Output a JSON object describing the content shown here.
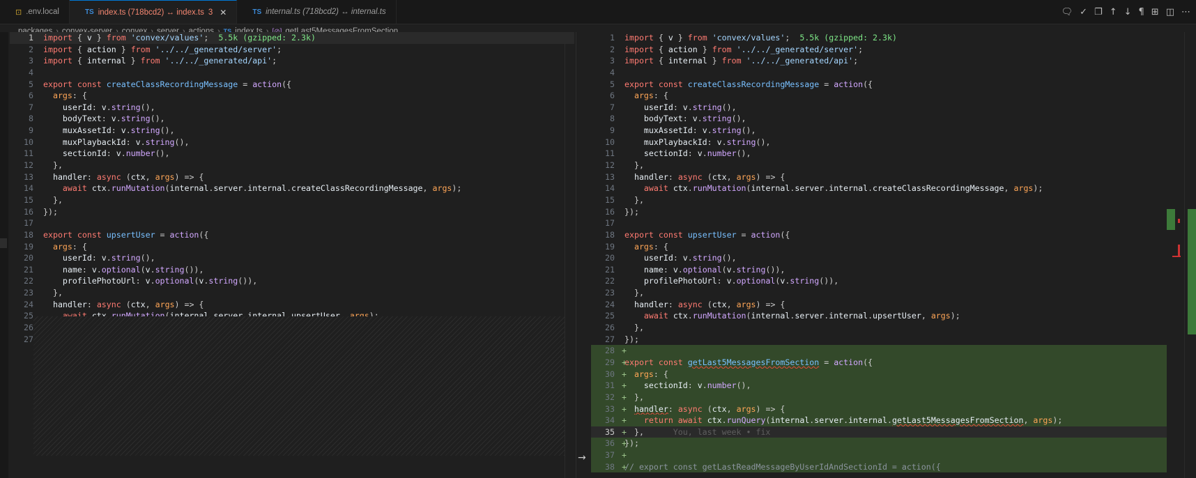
{
  "tabs": [
    {
      "icon": "env-icon",
      "label": ".env.local",
      "active": false
    },
    {
      "icon": "ts-icon",
      "label": "index.ts (718bcd2) ↔ index.ts",
      "badge": "3",
      "active": true
    },
    {
      "icon": "ts-icon",
      "label": "internal.ts (718bcd2) ↔ internal.ts",
      "active": false
    }
  ],
  "tab_icon_text": "TS",
  "tab_close": "✕",
  "toolbar": [
    "comment-icon",
    "check-icon",
    "copy-icon",
    "arrow-up-icon",
    "arrow-down-icon",
    "pilcrow-icon",
    "book-icon",
    "split-icon",
    "more-icon"
  ],
  "breadcrumbs": [
    "packages",
    "convex-server",
    "convex",
    "server",
    "actions",
    "index.ts",
    "getLast5MessagesFromSection"
  ],
  "left_lines": [
    "import { v } from 'convex/values';  5.5k (gzipped: 2.3k)",
    "import { action } from '../../_generated/server';",
    "import { internal } from '../../_generated/api';",
    "",
    "export const createClassRecordingMessage = action({",
    "  args: {",
    "    userId: v.string(),",
    "    bodyText: v.string(),",
    "    muxAssetId: v.string(),",
    "    muxPlaybackId: v.string(),",
    "    sectionId: v.number(),",
    "  },",
    "  handler: async (ctx, args) => {",
    "    await ctx.runMutation(internal.server.internal.createClassRecordingMessage, args);",
    "  },",
    "});",
    "",
    "export const upsertUser = action({",
    "  args: {",
    "    userId: v.string(),",
    "    name: v.optional(v.string()),",
    "    profilePhotoUrl: v.optional(v.string()),",
    "  },",
    "  handler: async (ctx, args) => {",
    "    await ctx.runMutation(internal.server.internal.upsertUser, args);",
    "  },",
    "});"
  ],
  "right_extra_lines": [
    "",
    "export const getLast5MessagesFromSection = action({",
    "  args: {",
    "    sectionId: v.number(),",
    "  },",
    "  handler: async (ctx, args) => {",
    "    return await ctx.runQuery(internal.server.internal.getLast5MessagesFromSection, args);",
    "  },",
    "});",
    "",
    "// export const getLastReadMessageByUserIdAndSectionId = action({"
  ],
  "inline_blame": "You, last week • fix",
  "diff_arrow": "→",
  "current_line": 35
}
